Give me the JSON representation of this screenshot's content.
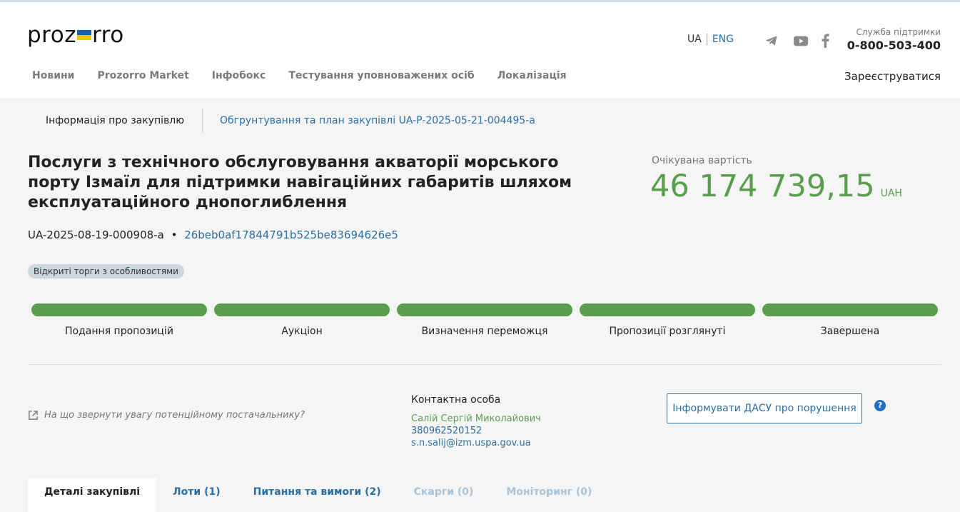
{
  "header": {
    "logo": {
      "left": "proz",
      "right": "rro",
      "flag_colors": [
        "#1a5fb4",
        "#f5c400"
      ]
    },
    "lang": {
      "ua": "UA",
      "eng": "ENG"
    },
    "social": [
      "telegram-icon",
      "youtube-icon",
      "facebook-icon"
    ],
    "support": {
      "label": "Служба підтримки",
      "phone": "0-800-503-400"
    },
    "nav": [
      "Новини",
      "Prozorro Market",
      "Інфобокс",
      "Тестування уповноважених осіб",
      "Локалізація"
    ],
    "register": "Зареєструватися"
  },
  "subnav": {
    "current": "Інформація про закупівлю",
    "plan_link": "Обгрунтування та план закупівлі UA-P-2025-05-21-004495-a"
  },
  "tender": {
    "title": "Послуги з технічного обслуговування акваторії морського порту Ізмаїл для підтримки навігаційних габаритів шляхом експлуатаційного днопоглиблення",
    "id": "UA-2025-08-19-000908-a",
    "separator": "•",
    "hash": "26beb0af17844791b525be83694626e5",
    "procedure": "Відкриті торги з особливостями",
    "expected_label": "Очікувана вартість",
    "expected_value": "46 174 739,15",
    "currency": "UAH"
  },
  "stages": [
    {
      "label": "Подання пропозицій",
      "complete": true
    },
    {
      "label": "Аукціон",
      "complete": true
    },
    {
      "label": "Визначення переможця",
      "complete": true
    },
    {
      "label": "Пропозиції розглянуті",
      "complete": true
    },
    {
      "label": "Завершена",
      "complete": true
    }
  ],
  "hint": "На що звернути увагу потенційному постачальнику?",
  "contact": {
    "heading": "Контактна особа",
    "name": "Салій Сергій Миколайович",
    "phone": "380962520152",
    "email": "s.n.salij@izm.uspa.gov.ua"
  },
  "dasu_button": "Інформувати ДАСУ про порушення",
  "help_icon": "?",
  "tabs": [
    {
      "label": "Деталі закупівлі",
      "state": "active"
    },
    {
      "label": "Лоти (1)",
      "state": "normal"
    },
    {
      "label": "Питання та вимоги (2)",
      "state": "normal"
    },
    {
      "label": "Скарги (0)",
      "state": "disabled"
    },
    {
      "label": "Моніторинг (0)",
      "state": "disabled"
    }
  ],
  "colors": {
    "accent": "#2a6ea6",
    "success": "#5b9d4f"
  }
}
